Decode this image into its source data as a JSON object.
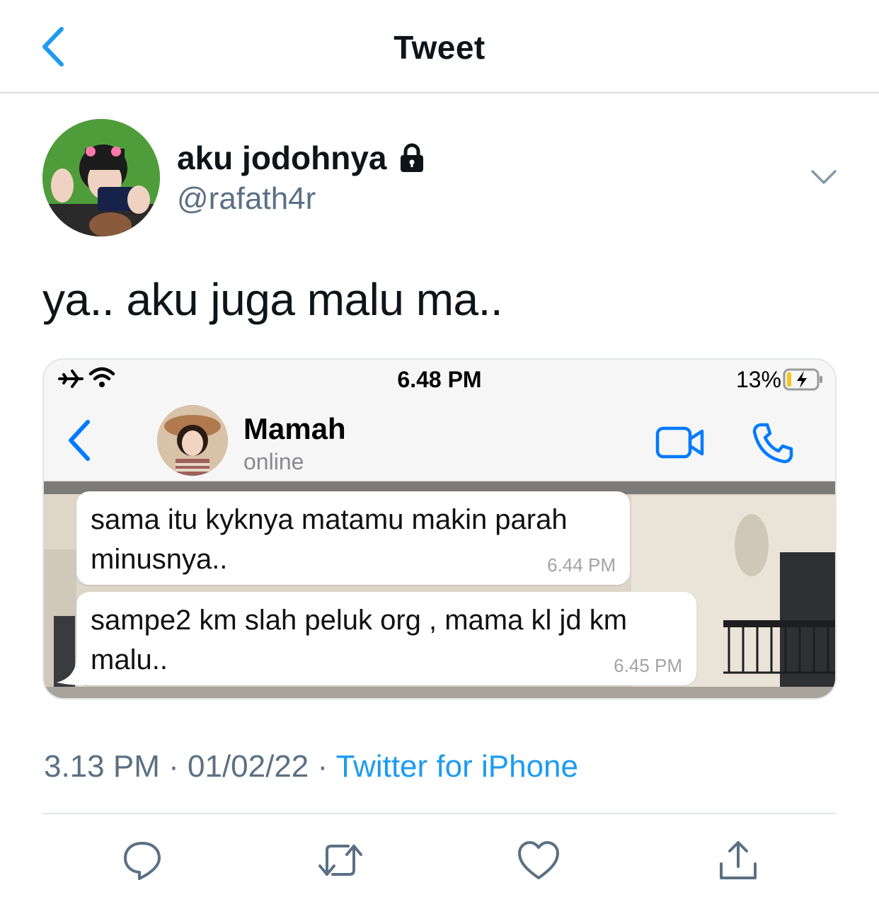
{
  "nav": {
    "title": "Tweet"
  },
  "author": {
    "display_name": "aku jodohnya",
    "handle": "@rafath4r",
    "protected": true
  },
  "tweet": {
    "text": "ya.. aku juga malu ma.."
  },
  "screenshot": {
    "status_bar": {
      "time": "6.48 PM",
      "battery": "13%"
    },
    "chat_header": {
      "contact_name": "Mamah",
      "contact_status": "online"
    },
    "messages": [
      {
        "text_line1": "sama itu kyknya matamu makin parah",
        "text_line2": "minusnya..",
        "time": "6.44 PM"
      },
      {
        "text_line1": "sampe2 km slah peluk org , mama kl jd km",
        "text_line2": "malu..",
        "time": "6.45 PM"
      }
    ]
  },
  "meta": {
    "time": "3.13 PM",
    "separator": "·",
    "date": "01/02/22",
    "source": "Twitter for iPhone"
  },
  "colors": {
    "accent": "#1d9bf0",
    "secondary_text": "#5b7083",
    "icon_gray": "#5b7083",
    "whatsapp_blue": "#007aff"
  },
  "actions": [
    "reply-icon",
    "retweet-icon",
    "like-icon",
    "share-icon"
  ]
}
